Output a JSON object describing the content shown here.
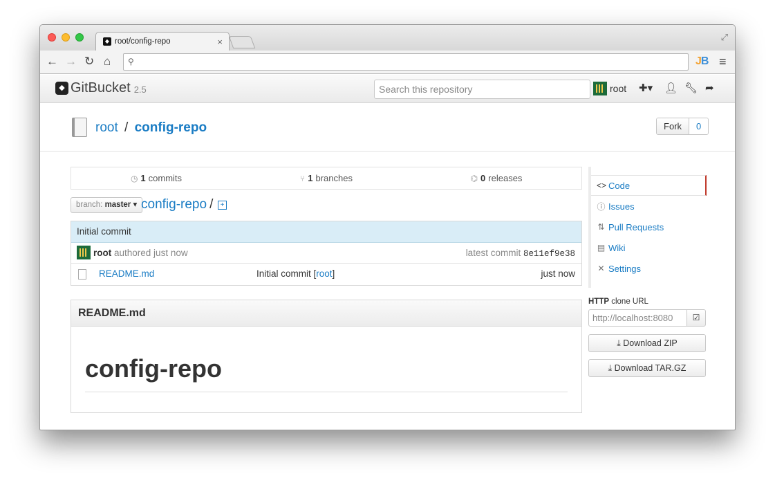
{
  "browser": {
    "tab_title": "root/config-repo",
    "address": ""
  },
  "app": {
    "brand": "GitBucket",
    "version": "2.5",
    "search_placeholder": "Search this repository",
    "user": "root"
  },
  "repo": {
    "owner": "root",
    "separator": "/",
    "name": "config-repo",
    "fork_label": "Fork",
    "fork_count": "0"
  },
  "stats": {
    "commits_count": "1",
    "commits_label": "commits",
    "branches_count": "1",
    "branches_label": "branches",
    "releases_count": "0",
    "releases_label": "releases"
  },
  "branch": {
    "prefix": "branch:",
    "name": "master",
    "path": "config-repo",
    "path_sep": "/"
  },
  "commit": {
    "message": "Initial commit",
    "author": "root",
    "authored_text": "authored just now",
    "latest_label": "latest commit",
    "sha": "8e11ef9e38"
  },
  "files": [
    {
      "name": "README.md",
      "message": "Initial commit [",
      "message_author": "root",
      "message_end": "]",
      "date": "just now"
    }
  ],
  "readme": {
    "title": "README.md",
    "heading": "config-repo"
  },
  "sidebar": {
    "items": [
      {
        "label": "Code",
        "icon": "code-icon"
      },
      {
        "label": "Issues",
        "icon": "issue-icon"
      },
      {
        "label": "Pull Requests",
        "icon": "pull-request-icon"
      },
      {
        "label": "Wiki",
        "icon": "book-icon"
      },
      {
        "label": "Settings",
        "icon": "tools-icon"
      }
    ],
    "clone_protocol": "HTTP",
    "clone_label": "clone URL",
    "clone_url": "http://localhost:8080",
    "download_zip": "Download ZIP",
    "download_tar": "Download TAR.GZ"
  }
}
